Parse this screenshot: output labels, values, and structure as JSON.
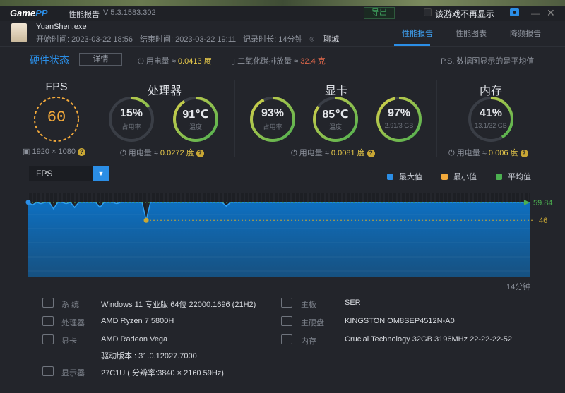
{
  "titlebar": {
    "logo_a": "Game",
    "logo_b": "PP",
    "title": "性能报告",
    "version": "V 5.3.1583.302",
    "export": "导出",
    "hide_label": "该游戏不再显示"
  },
  "header": {
    "game": "YuanShen.exe",
    "start": "开始时间: 2023-03-22 18:56",
    "end": "结束时间: 2023-03-22 19:11",
    "duration": "记录时长: 14分钟",
    "city": "聊城",
    "tabs": [
      {
        "label": "性能报告"
      },
      {
        "label": "性能图表"
      },
      {
        "label": "降频报告"
      }
    ]
  },
  "status": {
    "title": "硬件状态",
    "detail": "详情",
    "power_label": "用电量 ≈",
    "power": "0.0413 度",
    "co2_label": "二氧化碳排放量 ≈",
    "co2": "32.4 克",
    "note": "P.S. 数据图显示的是平均值"
  },
  "fps": {
    "title": "FPS",
    "value": "60",
    "resolution": "1920 × 1080"
  },
  "cpu": {
    "title": "处理器",
    "usage": "15%",
    "usage_label": "占用率",
    "usage_frac": 0.15,
    "temp": "91℃",
    "temp_label": "温度",
    "temp_frac": 0.91,
    "power_label": "用电量 ≈",
    "power": "0.0272 度"
  },
  "gpu": {
    "title": "显卡",
    "usage": "93%",
    "usage_label": "占用率",
    "usage_frac": 0.93,
    "temp": "85℃",
    "temp_label": "温度",
    "temp_frac": 0.85,
    "mem": "97%",
    "mem_label": "2.91/3 GB",
    "mem_frac": 0.97,
    "power_label": "用电量 ≈",
    "power": "0.0081 度"
  },
  "ram": {
    "title": "内存",
    "usage": "41%",
    "usage_label": "13.1/32 GB",
    "usage_frac": 0.41,
    "power_label": "用电量 ≈",
    "power": "0.006 度"
  },
  "chart_ctrl": {
    "selected": "FPS",
    "legend": [
      {
        "label": "最大值",
        "color": "#2b8ee6"
      },
      {
        "label": "最小值",
        "color": "#f2a93b"
      },
      {
        "label": "平均值",
        "color": "#4cb050"
      }
    ]
  },
  "chart_data": {
    "type": "area",
    "title": "FPS",
    "ylim": [
      0,
      67
    ],
    "max": 60,
    "min": 46,
    "avg": 59.84,
    "avg_label": "59.84",
    "min_label": "46",
    "x_end_label": "14分钟",
    "values": [
      60,
      58,
      60,
      59,
      60,
      60,
      55,
      60,
      60,
      59,
      60,
      56,
      60,
      60,
      60,
      60,
      60,
      56,
      60,
      60,
      60,
      59,
      60,
      60,
      60,
      60,
      60,
      60,
      46,
      60,
      60,
      60,
      60,
      60,
      60,
      60,
      60,
      60,
      60,
      60,
      60,
      60,
      60,
      60,
      60,
      60,
      60,
      57,
      60,
      60,
      60,
      60,
      60,
      60,
      60,
      60,
      60,
      60,
      60,
      60,
      60,
      60,
      60,
      60,
      60,
      60,
      60,
      60,
      60,
      60,
      60,
      60,
      60,
      60,
      60,
      60,
      60,
      60,
      60,
      60,
      60,
      60,
      60,
      60,
      60,
      60,
      60,
      60,
      60,
      60,
      60,
      60,
      60,
      60,
      60,
      60,
      60,
      60,
      60,
      60,
      60,
      60,
      60,
      60,
      60,
      60,
      60,
      60,
      60,
      60,
      60,
      60,
      60,
      60,
      60,
      60,
      60,
      60,
      60,
      60
    ]
  },
  "sysinfo": {
    "left": [
      {
        "label": "系 统",
        "value": "Windows 11 专业版 64位 22000.1696 (21H2)"
      },
      {
        "label": "处理器",
        "value": "AMD Ryzen 7 5800H"
      },
      {
        "label": "显卡",
        "value": "AMD Radeon Vega"
      },
      {
        "label": "",
        "value": "驱动版本 : 31.0.12027.7000"
      },
      {
        "label": "显示器",
        "value": "27C1U ( 分辨率:3840 × 2160 59Hz)"
      }
    ],
    "right": [
      {
        "label": "主板",
        "value": "SER"
      },
      {
        "label": "主硬盘",
        "value": "KINGSTON OM8SEP4512N-A0"
      },
      {
        "label": "内存",
        "value": "Crucial Technology 32GB 3196MHz 22-22-22-52"
      }
    ]
  }
}
